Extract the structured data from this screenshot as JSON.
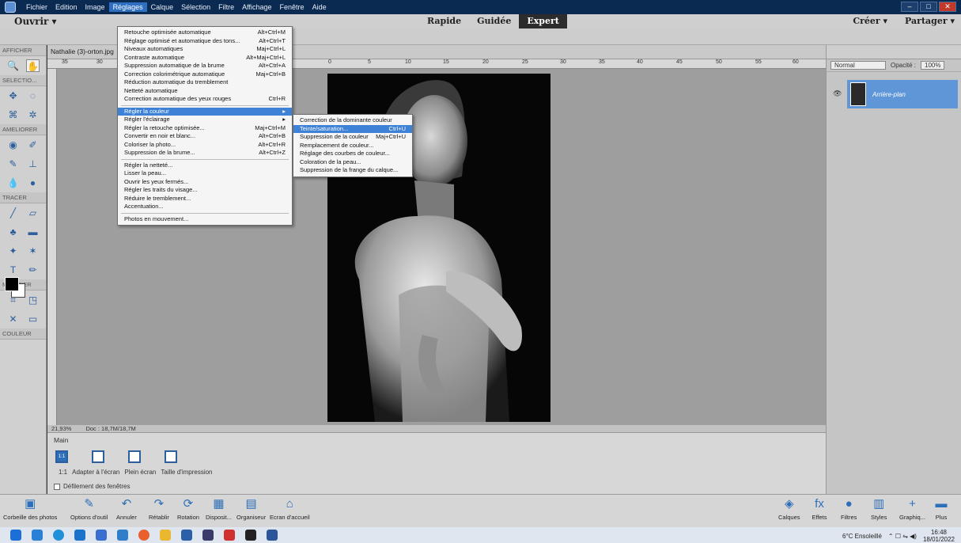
{
  "menubar": {
    "items": [
      "Fichier",
      "Edition",
      "Image",
      "Réglages",
      "Calque",
      "Sélection",
      "Filtre",
      "Affichage",
      "Fenêtre",
      "Aide"
    ],
    "active": "Réglages"
  },
  "header": {
    "open_label": "Ouvrir",
    "tabs": [
      "Rapide",
      "Guidée",
      "Expert"
    ],
    "active_tab": "Expert",
    "create_label": "Créer",
    "share_label": "Partager"
  },
  "document": {
    "tab_label": "Nathalie (3)-orton.jpg",
    "zoom": "21,93%",
    "doc_size": "Doc : 18,7M/18,7M"
  },
  "ruler_numbers": [
    "35",
    "30",
    "0",
    "5",
    "10",
    "15",
    "20",
    "25",
    "30",
    "35",
    "40",
    "45",
    "50",
    "55",
    "60"
  ],
  "tools": {
    "sections": [
      "AFFICHER",
      "SELECTIO...",
      "AMELIORER",
      "TRACER",
      "MODIFIER",
      "COULEUR"
    ]
  },
  "reglages_menu": {
    "group1": [
      {
        "label": "Retouche optimisée automatique",
        "shortcut": "Alt+Ctrl+M"
      },
      {
        "label": "Réglage optimisé et automatique des tons...",
        "shortcut": "Alt+Ctrl+T"
      },
      {
        "label": "Niveaux automatiques",
        "shortcut": "Maj+Ctrl+L"
      },
      {
        "label": "Contraste automatique",
        "shortcut": "Alt+Maj+Ctrl+L"
      },
      {
        "label": "Suppression automatique de la brume",
        "shortcut": "Alt+Ctrl+A"
      },
      {
        "label": "Correction colorimétrique automatique",
        "shortcut": "Maj+Ctrl+B"
      },
      {
        "label": "Réduction automatique du tremblement",
        "shortcut": ""
      },
      {
        "label": "Netteté automatique",
        "shortcut": ""
      },
      {
        "label": "Correction automatique des yeux rouges",
        "shortcut": "Ctrl+R"
      }
    ],
    "group2": [
      {
        "label": "Régler la couleur",
        "shortcut": "▸"
      },
      {
        "label": "Régler l'éclairage",
        "shortcut": "▸"
      },
      {
        "label": "Régler la retouche optimisée...",
        "shortcut": "Maj+Ctrl+M"
      },
      {
        "label": "Convertir en noir et blanc...",
        "shortcut": "Alt+Ctrl+B"
      },
      {
        "label": "Coloriser la photo...",
        "shortcut": "Alt+Ctrl+R"
      },
      {
        "label": "Suppression de la brume...",
        "shortcut": "Alt+Ctrl+Z"
      }
    ],
    "group3": [
      {
        "label": "Régler la netteté...",
        "shortcut": ""
      },
      {
        "label": "Lisser la peau...",
        "shortcut": ""
      },
      {
        "label": "Ouvrir les yeux fermés...",
        "shortcut": ""
      },
      {
        "label": "Régler les traits du visage...",
        "shortcut": ""
      },
      {
        "label": "Réduire le tremblement...",
        "shortcut": ""
      },
      {
        "label": "Accentuation...",
        "shortcut": ""
      }
    ],
    "group4": [
      {
        "label": "Photos en mouvement...",
        "shortcut": ""
      }
    ]
  },
  "couleur_submenu": [
    {
      "label": "Correction de la dominante couleur",
      "shortcut": ""
    },
    {
      "label": "Teinte/saturation...",
      "shortcut": "Ctrl+U"
    },
    {
      "label": "Suppression de la couleur",
      "shortcut": "Maj+Ctrl+U"
    },
    {
      "label": "Remplacement de couleur...",
      "shortcut": ""
    },
    {
      "label": "Réglage des courbes de couleur...",
      "shortcut": ""
    },
    {
      "label": "Coloration de la peau...",
      "shortcut": ""
    },
    {
      "label": "Suppression de la frange du calque...",
      "shortcut": ""
    }
  ],
  "options_panel": {
    "title": "Main",
    "first_icon": "1:1",
    "labels": [
      "1:1",
      "Adapter à l'écran",
      "Plein écran",
      "Taille d'impression"
    ],
    "checkbox": "Défilement des fenêtres"
  },
  "layers_panel": {
    "blend_mode": "Normal",
    "opacity_label": "Opacité :",
    "opacity_value": "100%",
    "layer_name": "Arrière-plan"
  },
  "panelbar_left": [
    "Corbeille des photos",
    "Options d'outil",
    "Annuler",
    "Rétablir",
    "Rotation",
    "Disposit...",
    "Organiseur",
    "Ecran d'accueil"
  ],
  "panelbar_right": [
    "Calques",
    "Effets",
    "Filtres",
    "Styles",
    "Graphiq...",
    "Plus"
  ],
  "taskbar": {
    "weather": "6°C Ensoleillé",
    "time": "16:48",
    "date": "18/01/2022"
  }
}
